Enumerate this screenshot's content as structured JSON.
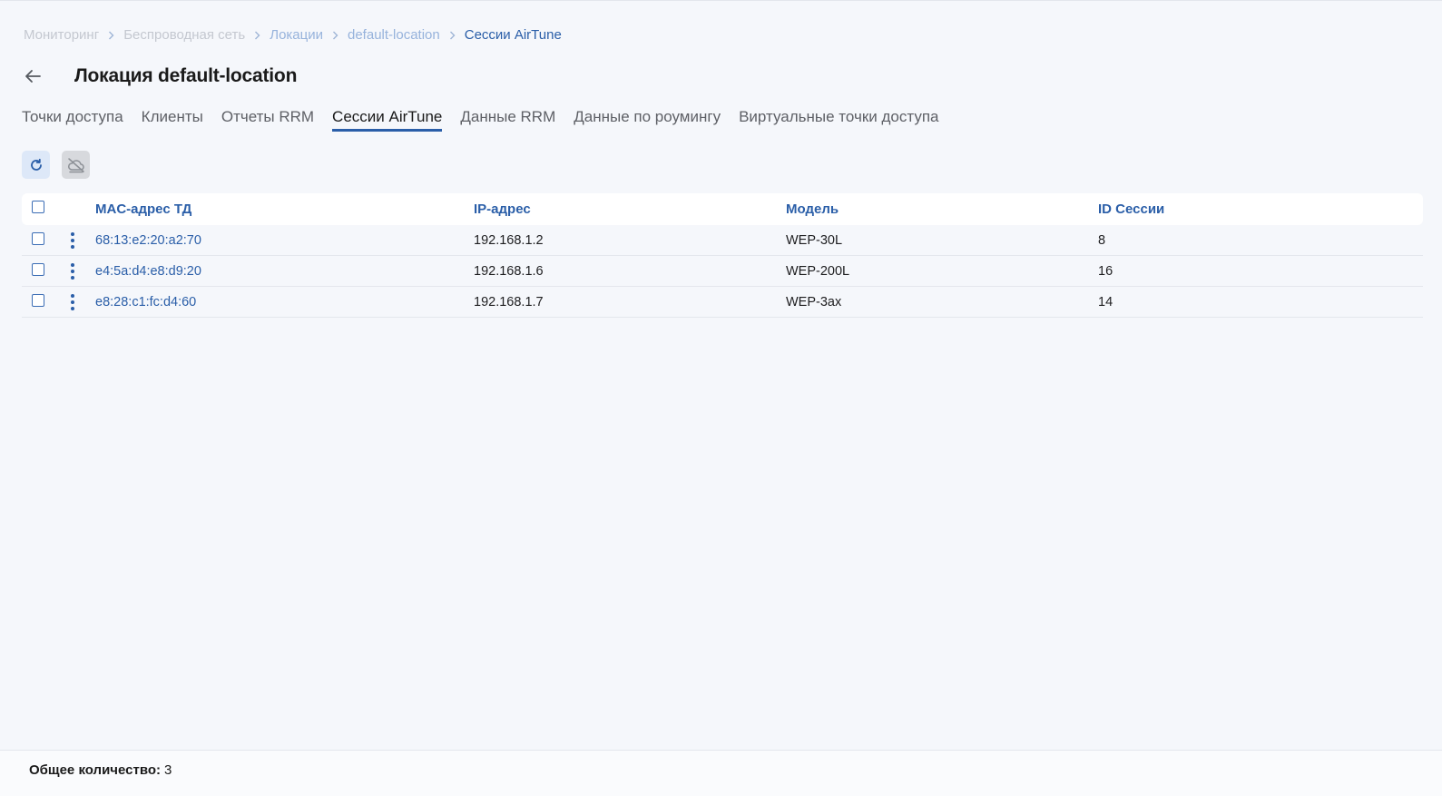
{
  "breadcrumb": [
    "Мониторинг",
    "Беспроводная сеть",
    "Локации",
    "default-location",
    "Сессии AirTune"
  ],
  "header": {
    "title": "Локация default-location",
    "back_icon": "arrow-left-icon"
  },
  "tabs": [
    {
      "label": "Точки доступа",
      "active": false
    },
    {
      "label": "Клиенты",
      "active": false
    },
    {
      "label": "Отчеты RRM",
      "active": false
    },
    {
      "label": "Сессии AirTune",
      "active": true
    },
    {
      "label": "Данные RRM",
      "active": false
    },
    {
      "label": "Данные по роумингу",
      "active": false
    },
    {
      "label": "Виртуальные точки доступа",
      "active": false
    }
  ],
  "toolbar": {
    "refresh_icon": "refresh-icon",
    "disabled_icon": "cloud-off-icon"
  },
  "table": {
    "columns": [
      "MAC-адрес ТД",
      "IP-адрес",
      "Модель",
      "ID Сессии"
    ],
    "rows": [
      {
        "mac": "68:13:e2:20:a2:70",
        "ip": "192.168.1.2",
        "model": "WEP-30L",
        "session_id": "8"
      },
      {
        "mac": "e4:5a:d4:e8:d9:20",
        "ip": "192.168.1.6",
        "model": "WEP-200L",
        "session_id": "16"
      },
      {
        "mac": "e8:28:c1:fc:d4:60",
        "ip": "192.168.1.7",
        "model": "WEP-3ax",
        "session_id": "14"
      }
    ]
  },
  "footer": {
    "total_label": "Общее количество:",
    "total_value": "3"
  },
  "colors": {
    "accent": "#2a5ea8",
    "background": "#f5f7fb"
  }
}
